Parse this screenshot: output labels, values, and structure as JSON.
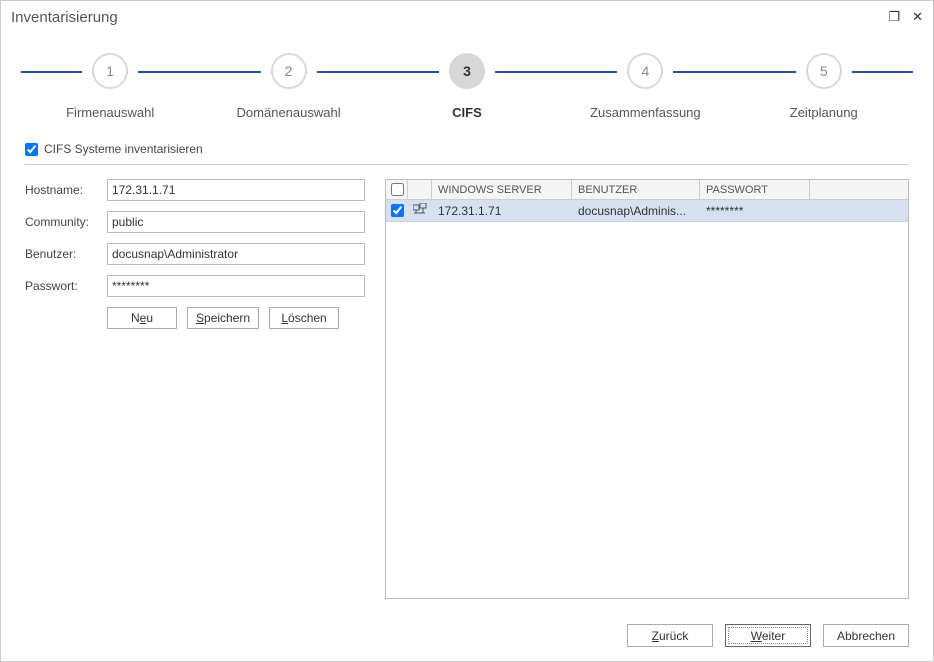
{
  "window": {
    "title": "Inventarisierung"
  },
  "steps": [
    {
      "num": "1",
      "label": "Firmenauswahl",
      "active": false
    },
    {
      "num": "2",
      "label": "Domänenauswahl",
      "active": false
    },
    {
      "num": "3",
      "label": "CIFS",
      "active": true
    },
    {
      "num": "4",
      "label": "Zusammenfassung",
      "active": false
    },
    {
      "num": "5",
      "label": "Zeitplanung",
      "active": false
    }
  ],
  "checkbox": {
    "label": "CIFS Systeme inventarisieren",
    "checked": true
  },
  "form": {
    "labels": {
      "hostname": "Hostname:",
      "community": "Community:",
      "user": "Benutzer:",
      "password": "Passwort:"
    },
    "values": {
      "hostname": "172.31.1.71",
      "community": "public",
      "user": "docusnap\\Administrator",
      "password": "********"
    },
    "buttons": {
      "new_pre": "N",
      "new_accel": "e",
      "new_post": "u",
      "save_pre": "",
      "save_accel": "S",
      "save_post": "peichern",
      "delete_pre": "",
      "delete_accel": "L",
      "delete_post": "öschen"
    }
  },
  "table": {
    "headers": {
      "server": "WINDOWS SERVER",
      "user": "BENUTZER",
      "password": "PASSWORT"
    },
    "rows": [
      {
        "checked": true,
        "server": "172.31.1.71",
        "user": "docusnap\\Adminis...",
        "password": "********"
      }
    ]
  },
  "footer": {
    "back_pre": "",
    "back_accel": "Z",
    "back_post": "urück",
    "next_pre": "",
    "next_accel": "W",
    "next_post": "eiter",
    "cancel": "Abbrechen"
  }
}
